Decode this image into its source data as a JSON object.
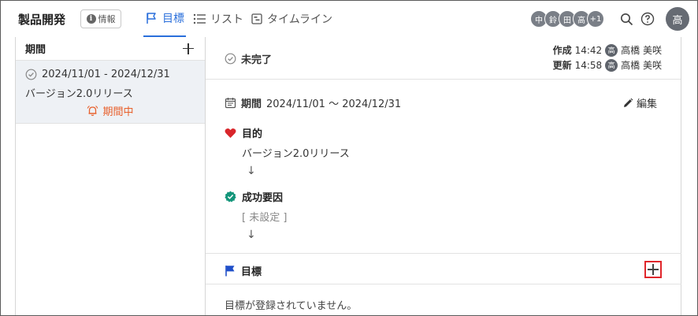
{
  "header": {
    "title": "製品開発",
    "info_label": "情報",
    "tabs": [
      {
        "label": "目標",
        "active": true
      },
      {
        "label": "リスト",
        "active": false
      },
      {
        "label": "タイムライン",
        "active": false
      }
    ],
    "avatars": [
      "中",
      "鈴",
      "田",
      "高",
      "+1"
    ],
    "user_avatar": "高"
  },
  "sidebar": {
    "title": "期間",
    "items": [
      {
        "range": "2024/11/01 - 2024/12/31",
        "name": "バージョン2.0リリース",
        "status": "期間中"
      }
    ]
  },
  "detail": {
    "status": "未完了",
    "created_label": "作成",
    "created_time": "14:42",
    "created_by_avatar": "高",
    "created_by": "高橋 美咲",
    "updated_label": "更新",
    "updated_time": "14:58",
    "updated_by_avatar": "高",
    "updated_by": "高橋 美咲",
    "period_label": "期間",
    "period_value": "2024/11/01 〜 2024/12/31",
    "edit_label": "編集",
    "purpose_label": "目的",
    "purpose_value": "バージョン2.0リリース",
    "success_label": "成功要因",
    "success_value": "[ 未設定 ]",
    "arrow": "↓",
    "goals_label": "目標",
    "empty_message": "目標が登録されていません。"
  },
  "colors": {
    "accent": "#2a6fdb",
    "warning": "#e8602c",
    "heart": "#d9262b",
    "success": "#13957a",
    "highlight_box": "#e0262b"
  }
}
